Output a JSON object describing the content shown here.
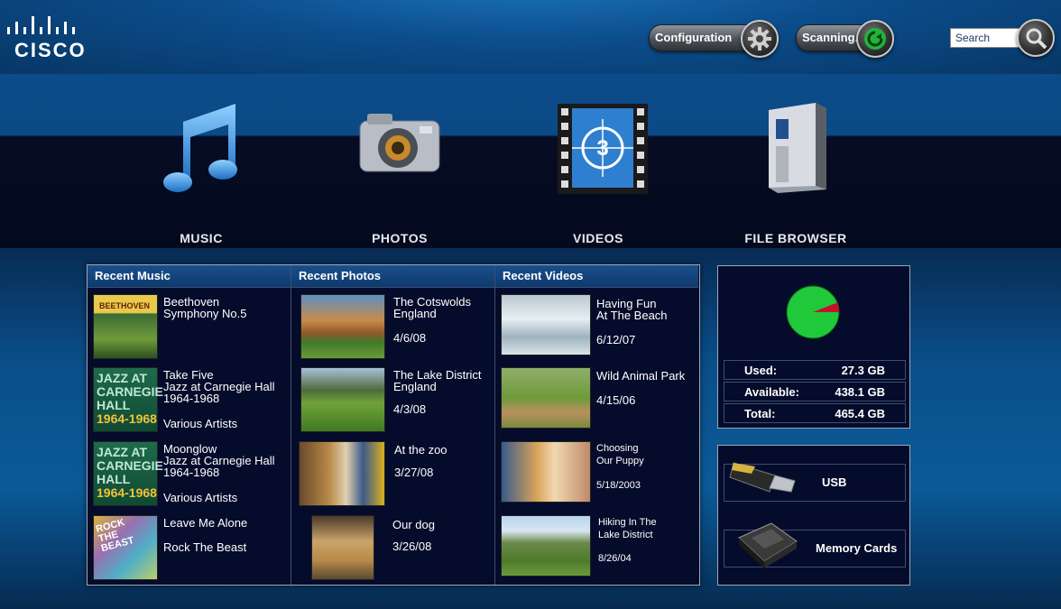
{
  "brand": {
    "logo_text": "CISCO"
  },
  "toolbar": {
    "configuration_label": "Configuration",
    "scanning_label": "Scanning...",
    "search_placeholder": "Search"
  },
  "categories": [
    {
      "label": "MUSIC",
      "icon": "music-note-icon"
    },
    {
      "label": "PHOTOS",
      "icon": "camera-icon"
    },
    {
      "label": "VIDEOS",
      "icon": "film-countdown-icon"
    },
    {
      "label": "FILE BROWSER",
      "icon": "server-tower-icon"
    }
  ],
  "recent": {
    "music_header": "Recent Music",
    "photos_header": "Recent Photos",
    "videos_header": "Recent Videos",
    "music": [
      {
        "line1": "Beethoven",
        "line2": "Symphony No.5",
        "line3": "",
        "artist": ""
      },
      {
        "line1": "Take Five",
        "line2": "Jazz at Carnegie Hall",
        "line3": "1964-1968",
        "artist": "Various Artists"
      },
      {
        "line1": "Moonglow",
        "line2": "Jazz at Carnegie Hall",
        "line3": "1964-1968",
        "artist": "Various Artists"
      },
      {
        "line1": "Leave Me Alone",
        "line2": "",
        "line3": "",
        "artist": "Rock The Beast"
      }
    ],
    "photos": [
      {
        "title1": "The Cotswolds",
        "title2": "England",
        "date": "4/6/08"
      },
      {
        "title1": "The Lake District",
        "title2": "England",
        "date": "4/3/08"
      },
      {
        "title1": "At the zoo",
        "title2": "",
        "date": "3/27/08"
      },
      {
        "title1": "Our dog",
        "title2": "",
        "date": "3/26/08"
      }
    ],
    "videos": [
      {
        "title1": "Having Fun",
        "title2": "At The Beach",
        "date": "6/12/07"
      },
      {
        "title1": "Wild Animal Park",
        "title2": "",
        "date": "4/15/06"
      },
      {
        "title1": "Choosing",
        "title2": "Our Puppy",
        "date": "5/18/2003"
      },
      {
        "title1": "Hiking In The",
        "title2": "Lake District",
        "date": "8/26/04"
      }
    ],
    "album_art": {
      "beethoven_text": "BEETHOVEN",
      "jazz_text1": "JAZZ AT",
      "jazz_text2": "CARNEGIE",
      "jazz_text3": "HALL",
      "jazz_text4": "1964-1968",
      "rock_text1": "ROCK",
      "rock_text2": "THE",
      "rock_text3": "BEAST"
    }
  },
  "storage": {
    "used_fraction": 0.059,
    "used_label": "Used:",
    "used_value": "27.3 GB",
    "available_label": "Available:",
    "available_value": "438.1 GB",
    "total_label": "Total:",
    "total_value": "465.4 GB",
    "colors": {
      "available": "#1fc93a",
      "used": "#c8102e"
    }
  },
  "devices": {
    "usb_label": "USB",
    "memory_label": "Memory Cards"
  }
}
